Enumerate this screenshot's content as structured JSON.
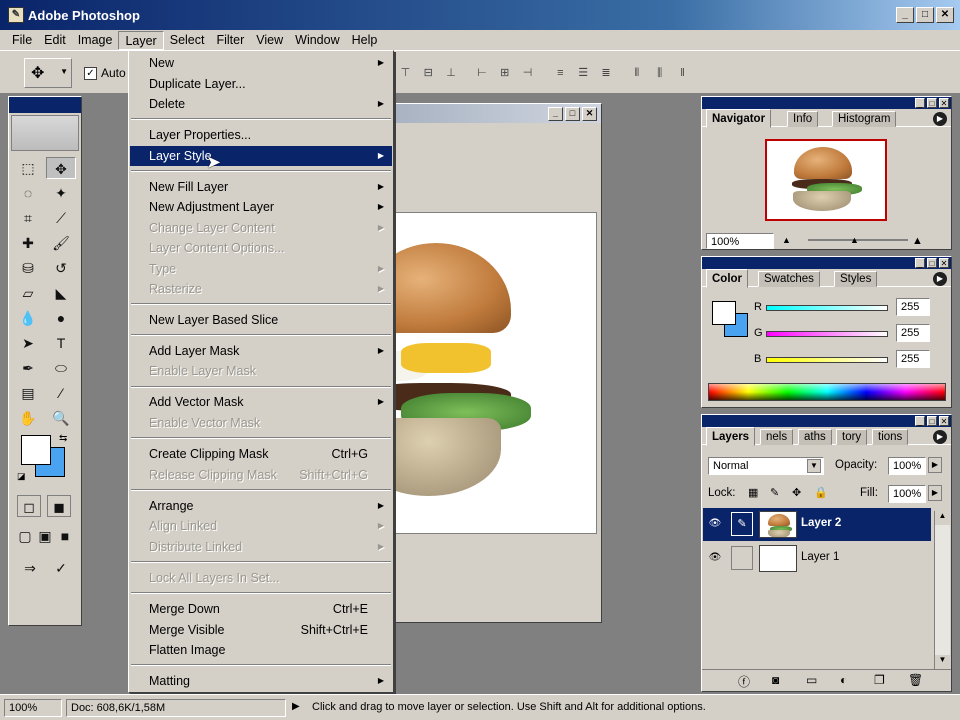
{
  "window": {
    "title": "Adobe Photoshop",
    "icon": "photoshop-feather-icon",
    "min_label": "_",
    "max_label": "□",
    "close_label": "✕"
  },
  "menubar": {
    "items": [
      "File",
      "Edit",
      "Image",
      "Layer",
      "Select",
      "Filter",
      "View",
      "Window",
      "Help"
    ],
    "active": "Layer"
  },
  "options": {
    "auto_select_label": "Auto"
  },
  "layer_menu": {
    "items": [
      {
        "label": "New",
        "submenu": true,
        "enabled": true
      },
      {
        "label": "Duplicate Layer...",
        "enabled": true
      },
      {
        "label": "Delete",
        "submenu": true,
        "enabled": true
      },
      {
        "label": "Layer Properties...",
        "enabled": true
      },
      {
        "label": "Layer Style",
        "submenu": true,
        "enabled": true,
        "highlighted": true
      },
      {
        "label": "New Fill Layer",
        "submenu": true,
        "enabled": true
      },
      {
        "label": "New Adjustment Layer",
        "submenu": true,
        "enabled": true
      },
      {
        "label": "Change Layer Content",
        "submenu": true,
        "enabled": false
      },
      {
        "label": "Layer Content Options...",
        "enabled": false
      },
      {
        "label": "Type",
        "submenu": true,
        "enabled": false
      },
      {
        "label": "Rasterize",
        "submenu": true,
        "enabled": false
      },
      {
        "label": "New Layer Based Slice",
        "enabled": true
      },
      {
        "label": "Add Layer Mask",
        "submenu": true,
        "enabled": true
      },
      {
        "label": "Enable Layer Mask",
        "enabled": false
      },
      {
        "label": "Add Vector Mask",
        "submenu": true,
        "enabled": true
      },
      {
        "label": "Enable Vector Mask",
        "enabled": false
      },
      {
        "label": "Create Clipping Mask",
        "shortcut": "Ctrl+G",
        "enabled": true
      },
      {
        "label": "Release Clipping Mask",
        "shortcut": "Shift+Ctrl+G",
        "enabled": false
      },
      {
        "label": "Arrange",
        "submenu": true,
        "enabled": true
      },
      {
        "label": "Align Linked",
        "submenu": true,
        "enabled": false
      },
      {
        "label": "Distribute Linked",
        "submenu": true,
        "enabled": false
      },
      {
        "label": "Lock All Layers In Set...",
        "enabled": false
      },
      {
        "label": "Merge Down",
        "shortcut": "Ctrl+E",
        "enabled": true
      },
      {
        "label": "Merge Visible",
        "shortcut": "Shift+Ctrl+E",
        "enabled": true
      },
      {
        "label": "Flatten Image",
        "enabled": true
      },
      {
        "label": "Matting",
        "submenu": true,
        "enabled": true
      }
    ]
  },
  "navigator": {
    "tabs": [
      "Navigator",
      "Info",
      "Histogram"
    ],
    "zoom": "100%"
  },
  "color": {
    "tabs": [
      "Color",
      "Swatches",
      "Styles"
    ],
    "channels": [
      {
        "label": "R",
        "value": "255",
        "color": "#00ffff"
      },
      {
        "label": "G",
        "value": "255",
        "color": "#ff00ff"
      },
      {
        "label": "B",
        "value": "255",
        "color": "#ffff00"
      }
    ]
  },
  "layers": {
    "tabs": [
      "Layers",
      "nels",
      "aths",
      "tory",
      "tions"
    ],
    "blend_mode": "Normal",
    "opacity_label": "Opacity:",
    "opacity": "100%",
    "lock_label": "Lock:",
    "fill_label": "Fill:",
    "fill": "100%",
    "rows": [
      {
        "name": "Layer 2",
        "selected": true
      },
      {
        "name": "Layer 1",
        "selected": false
      }
    ]
  },
  "status": {
    "zoom": "100%",
    "doc": "Doc: 608,6K/1,58M",
    "hint": "Click and drag to move layer or selection.  Use Shift and Alt for additional options."
  },
  "colors": {
    "titlebar": "#0a246a",
    "chrome": "#d4d0c8",
    "workspace": "#808080",
    "background_swatch": "#4aa3f0"
  }
}
